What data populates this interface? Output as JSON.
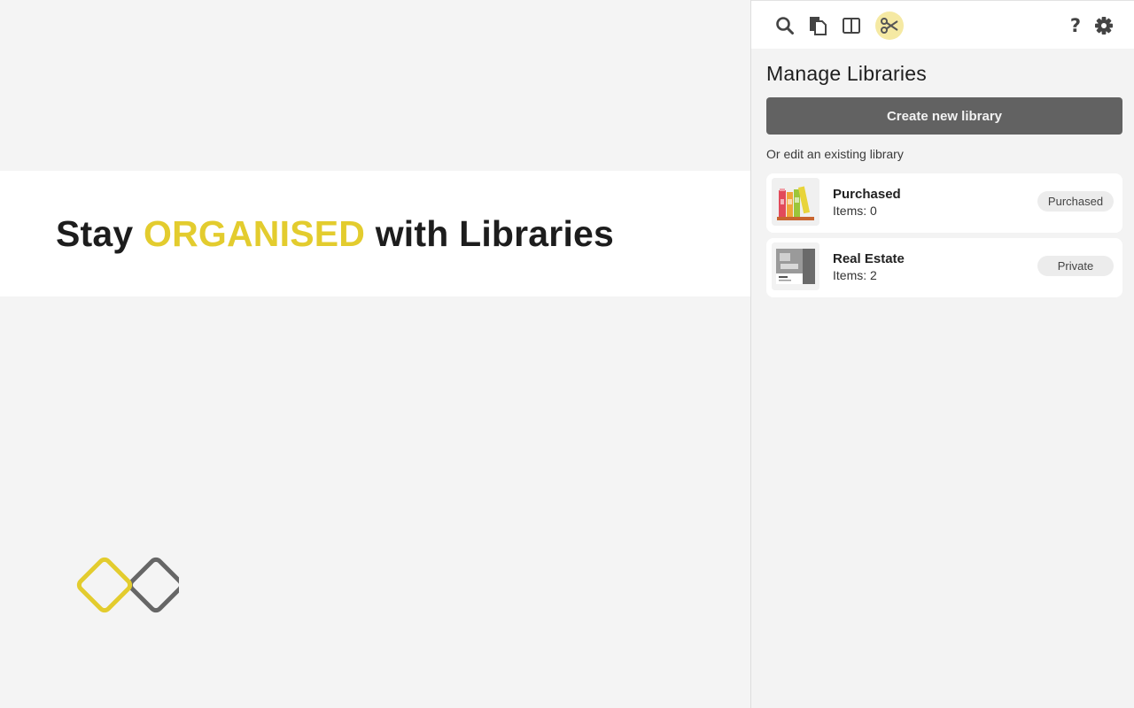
{
  "hero": {
    "title_before": "Stay ",
    "title_accent": "ORGANISED",
    "title_after": " with Libraries",
    "accent_color": "#e3cc2e"
  },
  "logo": {
    "icon": "double-diamond-logo",
    "colors": [
      "#e3cc2e",
      "#666666"
    ]
  },
  "toolbar": {
    "left_icons": [
      "search-icon",
      "pages-icon",
      "split-view-icon",
      "scissors-icon"
    ],
    "active_icon": "scissors-icon",
    "right_icons": [
      "help-icon",
      "gear-icon"
    ],
    "help_label": "?",
    "active_color": "#f5e9a3"
  },
  "panel": {
    "title": "Manage Libraries",
    "create_button": "Create new library",
    "subtitle": "Or edit an existing library",
    "libraries": [
      {
        "name": "Purchased",
        "items": "Items: 0",
        "badge": "Purchased",
        "thumb": "books-thumbnail"
      },
      {
        "name": "Real Estate",
        "items": "Items: 2",
        "badge": "Private",
        "thumb": "real-estate-thumbnail"
      }
    ]
  }
}
